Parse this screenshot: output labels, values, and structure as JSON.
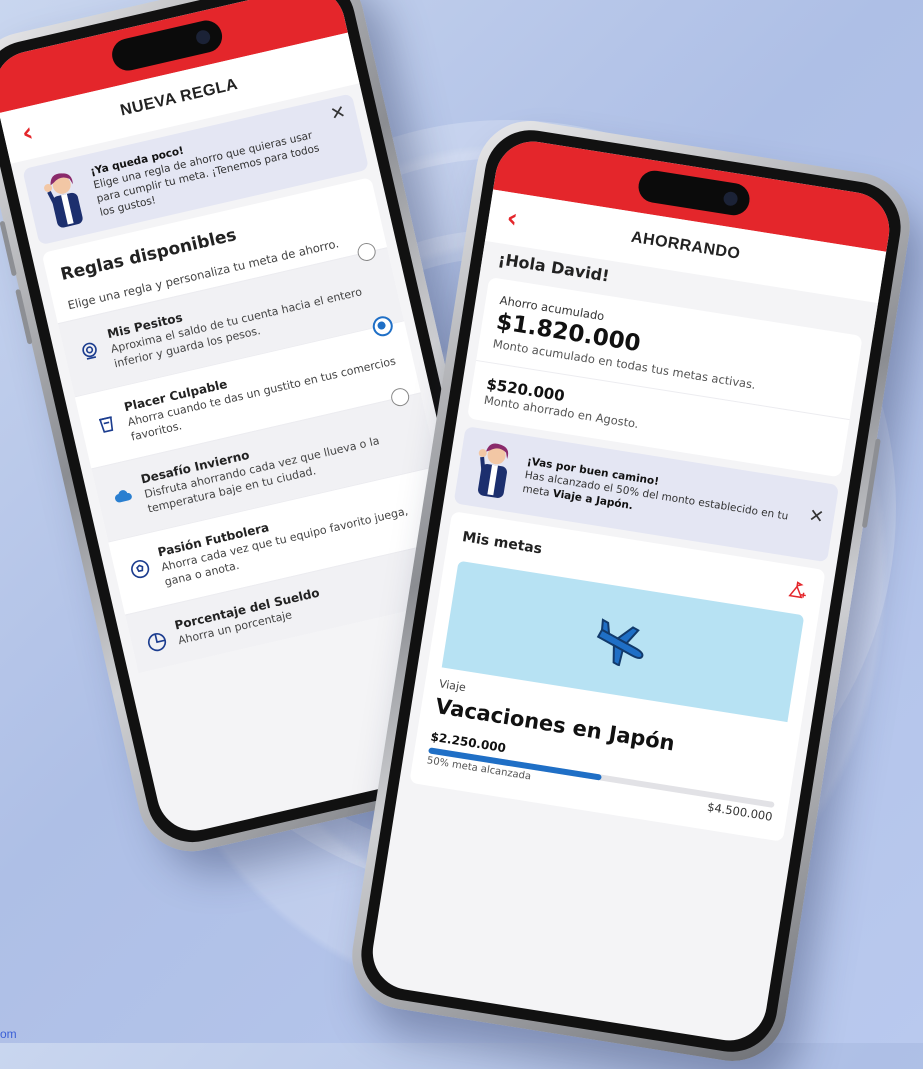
{
  "left_phone": {
    "nav_title": "NUEVA REGLA",
    "banner": {
      "title": "¡Ya queda poco!",
      "text": "Elige una regla de ahorro que quieras usar para cumplir tu meta. ¡Tenemos para todos los gustos!"
    },
    "rules": {
      "title": "Reglas disponibles",
      "subtitle": "Elige una regla y personaliza tu meta de ahorro.",
      "items": [
        {
          "name": "Mis Pesitos",
          "desc": "Aproxima el saldo de tu cuenta hacia el entero inferior y guarda los pesos.",
          "icon": "piggy-bank-icon",
          "selected": false
        },
        {
          "name": "Placer Culpable",
          "desc": "Ahorra cuando te das un gustito en tus comercios favoritos.",
          "icon": "coffee-cup-icon",
          "selected": true
        },
        {
          "name": "Desafío Invierno",
          "desc": "Disfruta ahorrando cada vez que llueva o la temperatura baje en tu ciudad.",
          "icon": "cloud-icon",
          "selected": false
        },
        {
          "name": "Pasión Futbolera",
          "desc": "Ahorra cada vez que tu equipo favorito juega, gana o anota.",
          "icon": "soccer-ball-icon",
          "selected": false
        },
        {
          "name": "Porcentaje del Sueldo",
          "desc": "Ahorra un porcentaje",
          "icon": "pie-chart-icon",
          "selected": false
        }
      ]
    }
  },
  "right_phone": {
    "nav_title": "AHORRANDO",
    "greeting": "¡Hola David!",
    "accumulated": {
      "label": "Ahorro acumulado",
      "amount": "$1.820.000",
      "note": "Monto acumulado en todas tus metas activas."
    },
    "monthly": {
      "amount": "$520.000",
      "note": "Monto ahorrado en Agosto."
    },
    "banner": {
      "title": "¡Vas por buen camino!",
      "text_before": "Has alcanzado el 50% del monto establecido en tu meta ",
      "goal_ref": "Viaje a Japón."
    },
    "goals": {
      "title": "Mis metas",
      "goal": {
        "category": "Viaje",
        "name": "Vacaciones en Japón",
        "current": "$2.250.000",
        "target": "$4.500.000",
        "progress_label": "50% meta alcanzada",
        "progress_fraction": 0.5
      }
    }
  },
  "footer_text": "om",
  "colors": {
    "brand_red": "#e4262b",
    "accent_blue": "#1f6fc6",
    "banner_bg": "#e4e6f3",
    "goal_image_bg": "#b7e2f3"
  }
}
